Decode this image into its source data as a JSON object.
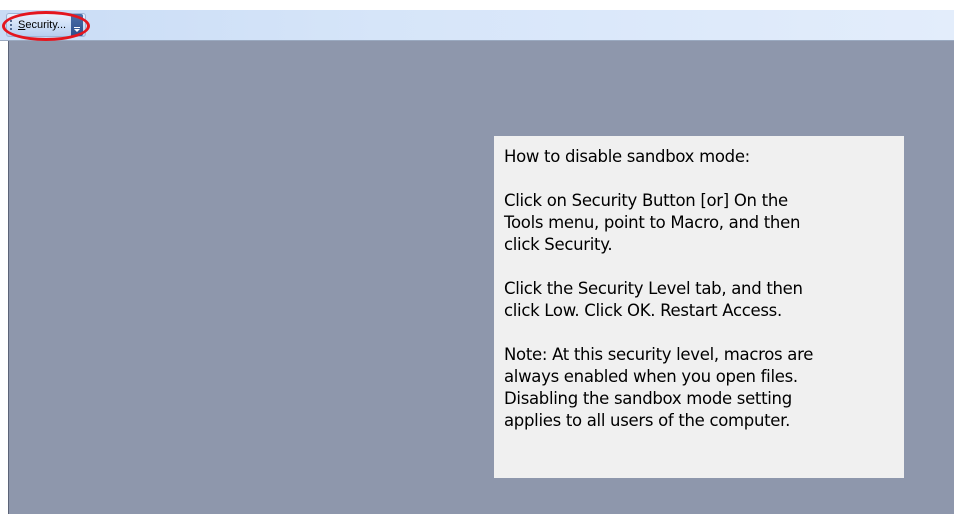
{
  "toolbar": {
    "security_button_mnemonic": "S",
    "security_button_rest": "ecurity...",
    "overflow_icon": "toolbar-overflow-chevron-icon"
  },
  "highlight": {
    "color": "#e4161e"
  },
  "workspace": {
    "background": "#8e97ac"
  },
  "note": {
    "title": "How to disable sandbox mode:",
    "step1": [
      "Click on Security Button [or] On the",
      "Tools menu, point to Macro, and then",
      "click Security."
    ],
    "step2": [
      "Click the Security Level tab, and then",
      "click Low.  Click OK.  Restart Access."
    ],
    "warning": [
      "Note:  At this security level, macros are",
      "always enabled when you open files.",
      "Disabling the sandbox mode setting",
      "applies to all users of the computer."
    ]
  }
}
